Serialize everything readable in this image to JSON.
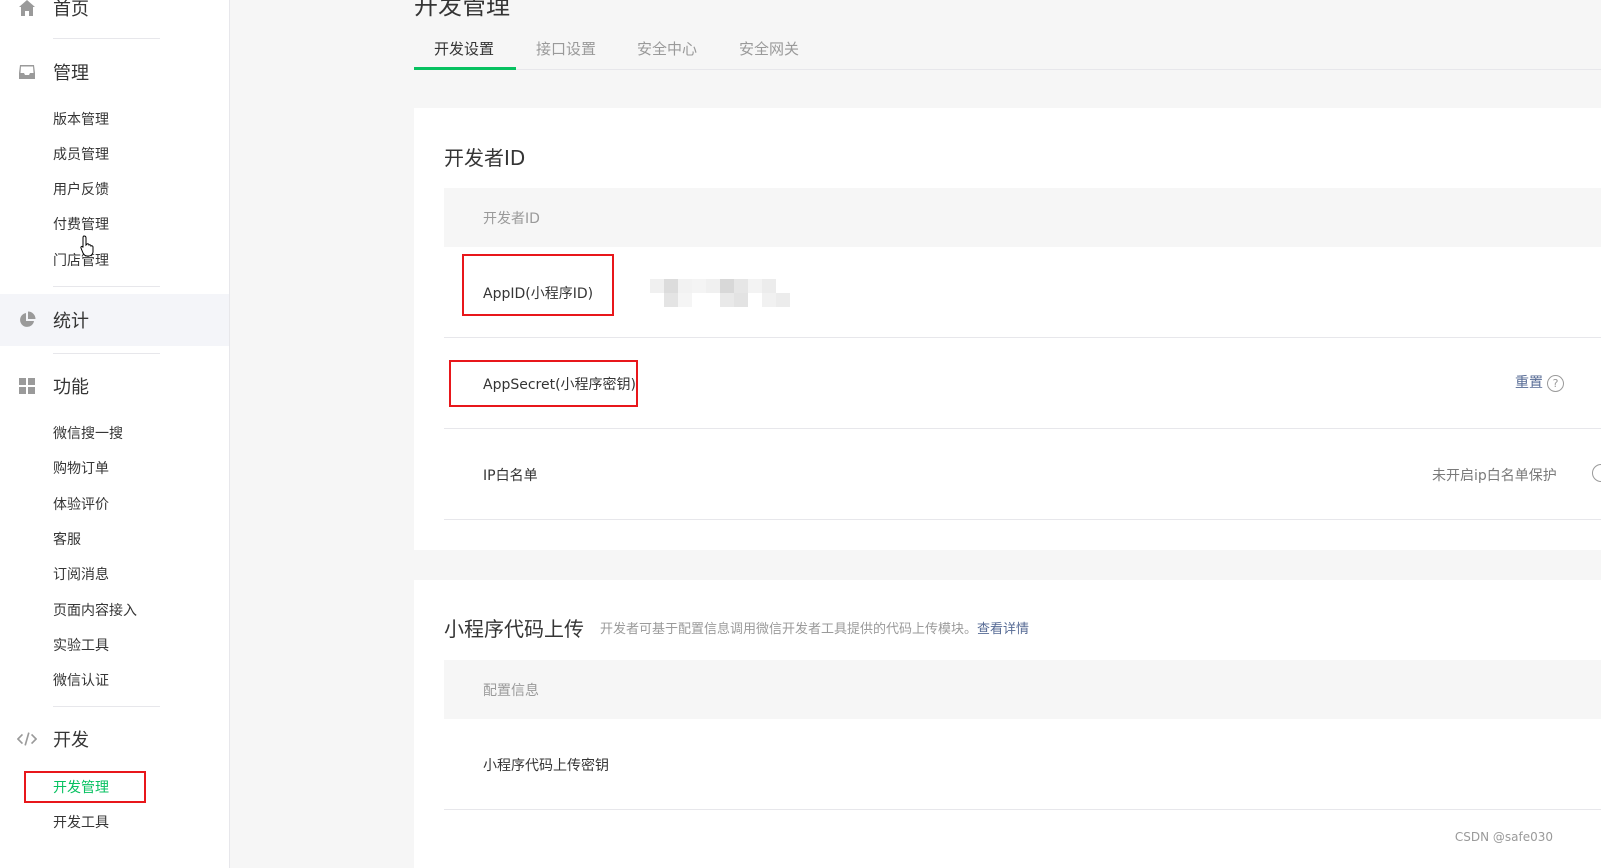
{
  "sidebar": {
    "home": "首页",
    "manage": {
      "label": "管理",
      "items": [
        "版本管理",
        "成员管理",
        "用户反馈",
        "付费管理",
        "门店管理"
      ]
    },
    "stats": "统计",
    "features": {
      "label": "功能",
      "items": [
        "微信搜一搜",
        "购物订单",
        "体验评价",
        "客服",
        "订阅消息",
        "页面内容接入",
        "实验工具",
        "微信认证"
      ]
    },
    "dev": {
      "label": "开发",
      "items": [
        "开发管理",
        "开发工具"
      ]
    }
  },
  "main": {
    "title": "开发管理",
    "tabs": [
      "开发设置",
      "接口设置",
      "安全中心",
      "安全网关"
    ],
    "developer_id": {
      "title": "开发者ID",
      "table_header": "开发者ID",
      "rows": {
        "appid_label": "AppID(小程序ID)",
        "appsecret_label": "AppSecret(小程序密钥)",
        "appsecret_action": "重置",
        "ip_label": "IP白名单",
        "ip_status": "未开启ip白名单保护"
      }
    },
    "upload": {
      "title": "小程序代码上传",
      "desc": "开发者可基于配置信息调用微信开发者工具提供的代码上传模块。",
      "link": "查看详情",
      "table_header": "配置信息",
      "row_label": "小程序代码上传密钥"
    }
  },
  "watermark": "CSDN @safe030",
  "colors": {
    "accent": "#07c160",
    "link": "#576b95",
    "highlight": "#e8171b"
  }
}
